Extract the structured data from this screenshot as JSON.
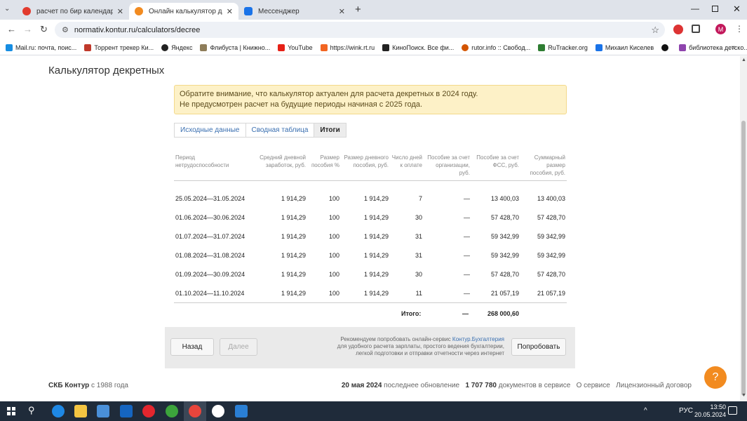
{
  "browser": {
    "tabs": [
      {
        "title": "расчет по бир календарь — Я",
        "color": "#e23b2e"
      },
      {
        "title": "Онлайн калькулятор для расч",
        "color": "#f28b20"
      },
      {
        "title": "Мессенджер",
        "color": "#1a73e8"
      }
    ],
    "url": "normativ.kontur.ru/calculators/decree",
    "bookmarks": [
      {
        "label": "Mail.ru: почта, поис...",
        "color": "#168de2"
      },
      {
        "label": "Торрент трекер Ки...",
        "color": "#c0392b"
      },
      {
        "label": "Яндекс",
        "color": "#222222"
      },
      {
        "label": "Флибуста | Книжно...",
        "color": "#8e7d5a"
      },
      {
        "label": "YouTube",
        "color": "#e62117"
      },
      {
        "label": "https://wink.rt.ru",
        "color": "#f26522"
      },
      {
        "label": "КиноПоиск. Все фи...",
        "color": "#222222"
      },
      {
        "label": "rutor.info :: Свобод...",
        "color": "#d35400"
      },
      {
        "label": "RuTracker.org",
        "color": "#2e7d32"
      },
      {
        "label": "Михаил Киселев",
        "color": "#1a73e8"
      },
      {
        "label": "",
        "color": "#111111"
      },
      {
        "label": "библиотека детско...",
        "color": "#8e44ad"
      }
    ],
    "profile_letter": "M"
  },
  "page": {
    "title": "Калькулятор декретных",
    "notice_line1": "Обратите внимание, что калькулятор актуален для расчета декретных в 2024 году.",
    "notice_line2": "Не предусмотрен расчет на будущие периоды начиная с 2025 года.",
    "steps": [
      "Исходные данные",
      "Сводная таблица",
      "Итоги"
    ],
    "columns": [
      "Период нетрудоспособности",
      "Средний дневной заработок, руб.",
      "Размер пособия %",
      "Размер дневного пособия, руб.",
      "Число дней к оплате",
      "Пособие за счет организации, руб.",
      "Пособие за счет ФСС, руб.",
      "Суммарный размер пособия, руб."
    ],
    "rows": [
      [
        "25.05.2024—31.05.2024",
        "1 914,29",
        "100",
        "1 914,29",
        "7",
        "—",
        "13 400,03",
        "13 400,03"
      ],
      [
        "01.06.2024—30.06.2024",
        "1 914,29",
        "100",
        "1 914,29",
        "30",
        "—",
        "57 428,70",
        "57 428,70"
      ],
      [
        "01.07.2024—31.07.2024",
        "1 914,29",
        "100",
        "1 914,29",
        "31",
        "—",
        "59 342,99",
        "59 342,99"
      ],
      [
        "01.08.2024—31.08.2024",
        "1 914,29",
        "100",
        "1 914,29",
        "31",
        "—",
        "59 342,99",
        "59 342,99"
      ],
      [
        "01.09.2024—30.09.2024",
        "1 914,29",
        "100",
        "1 914,29",
        "30",
        "—",
        "57 428,70",
        "57 428,70"
      ],
      [
        "01.10.2024—11.10.2024",
        "1 914,29",
        "100",
        "1 914,29",
        "11",
        "—",
        "21 057,19",
        "21 057,19"
      ]
    ],
    "total_label": "Итого:",
    "total_org": "—",
    "total_fss": "268 000,60",
    "back_label": "Назад",
    "next_label": "Далее",
    "promo_prefix": "Рекомендуем попробовать онлайн-сервис ",
    "promo_link": "Контур.Бухгалтерия",
    "promo_line2": "для удобного расчета зарплаты, простого ведения бухгалтерии,",
    "promo_line3": "легкой подготовки и отправки отчетности через интернет",
    "try_label": "Попробовать",
    "footer_brand": "СКБ Контур",
    "footer_since": " с 1988 года",
    "footer_date": "20 мая 2024",
    "footer_update": " последнее обновление",
    "footer_count": "1 707 780",
    "footer_docs": " документов в сервисе",
    "footer_about": "О сервисе",
    "footer_license": "Лицензионный договор",
    "help": "?"
  },
  "taskbar": {
    "lang": "РУС",
    "time": "13:50",
    "date": "20.05.2024"
  }
}
